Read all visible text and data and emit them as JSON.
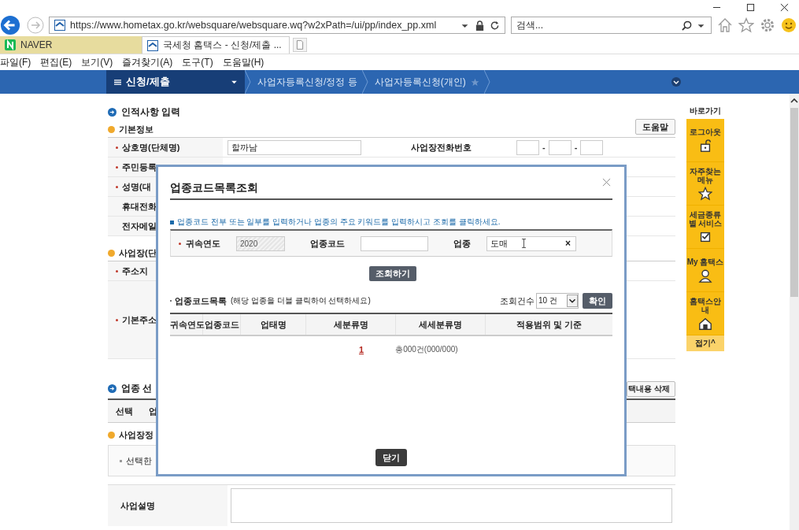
{
  "browser": {
    "address": "https://www.hometax.go.kr/websquare/websquare.wq?w2xPath=/ui/pp/index_pp.xml",
    "search_placeholder": "검색...",
    "tabs": [
      {
        "label": "NAVER",
        "selected": false
      },
      {
        "label": "국세청 홈택스 - 신청/제출 ...",
        "selected": true
      }
    ],
    "menu": [
      "파일(F)",
      "편집(E)",
      "보기(V)",
      "즐겨찾기(A)",
      "도구(T)",
      "도움말(H)"
    ]
  },
  "nav": {
    "menu": "신청/제출",
    "breadcrumbs": [
      "사업자등록신청/정정 등",
      "사업자등록신청(개인)"
    ]
  },
  "page": {
    "section_title": "인적사항 입력",
    "subsection": "기본정보",
    "help_button": "도움말",
    "rows": [
      {
        "label": "상호명(단체명)",
        "required": true,
        "value": "할까남"
      },
      {
        "label": "주민등록",
        "required": true
      },
      {
        "label": "성명(대",
        "required": true
      },
      {
        "label": "휴대전화",
        "required": false
      },
      {
        "label": "전자메일",
        "required": false
      }
    ],
    "phone_label": "사업장전화번호",
    "phone_separators": [
      "-",
      "-"
    ],
    "address_section": "사업장(단",
    "address_rows": [
      {
        "label": "주소지",
        "required": true
      },
      {
        "label": "기본주소",
        "required": true
      }
    ],
    "industry_title": "업종 선",
    "delete_button": "택내용 삭제",
    "industry_columns": [
      "선택",
      "업"
    ],
    "info_title": "사업장정",
    "info_note": "선택한",
    "description_label": "사업설명"
  },
  "quick_menu": {
    "title": "바로가기",
    "items": [
      {
        "label": "로그아웃",
        "kind": "lock"
      },
      {
        "label": "자주찾는 메뉴",
        "kind": "star"
      },
      {
        "label": "세금종류별 서비스",
        "kind": "check"
      },
      {
        "label": "My 홈택스",
        "kind": "person"
      },
      {
        "label": "홈택스안내",
        "kind": "house"
      }
    ],
    "collapse": "접기^"
  },
  "modal": {
    "title": "업종코드목록조회",
    "hint": "업종코드 전부 또는 일부를 입력하거나 업종의 주요 키워드를 입력하시고 조회를 클릭하세요.",
    "year_field": {
      "label": "귀속연도",
      "value": "2020"
    },
    "code_field": {
      "label": "업종코드"
    },
    "industry_field": {
      "label": "업종",
      "value": "도매",
      "clear": "×"
    },
    "search_button": "조회하기",
    "list_title": "업종코드목록",
    "list_note": "(해당 업종을 더블 클릭하여 선택하세요)",
    "count_label": "조회건수",
    "count_select": "10 건",
    "confirm_button": "확인",
    "columns": [
      "귀속연도",
      "업종코드",
      "업태명",
      "세분류명",
      "세세분류명",
      "적용범위 및 기준"
    ],
    "pages": [
      {
        "label": "1",
        "selected": true
      }
    ],
    "total": "총000건(000/000)",
    "close_button": "닫기"
  }
}
